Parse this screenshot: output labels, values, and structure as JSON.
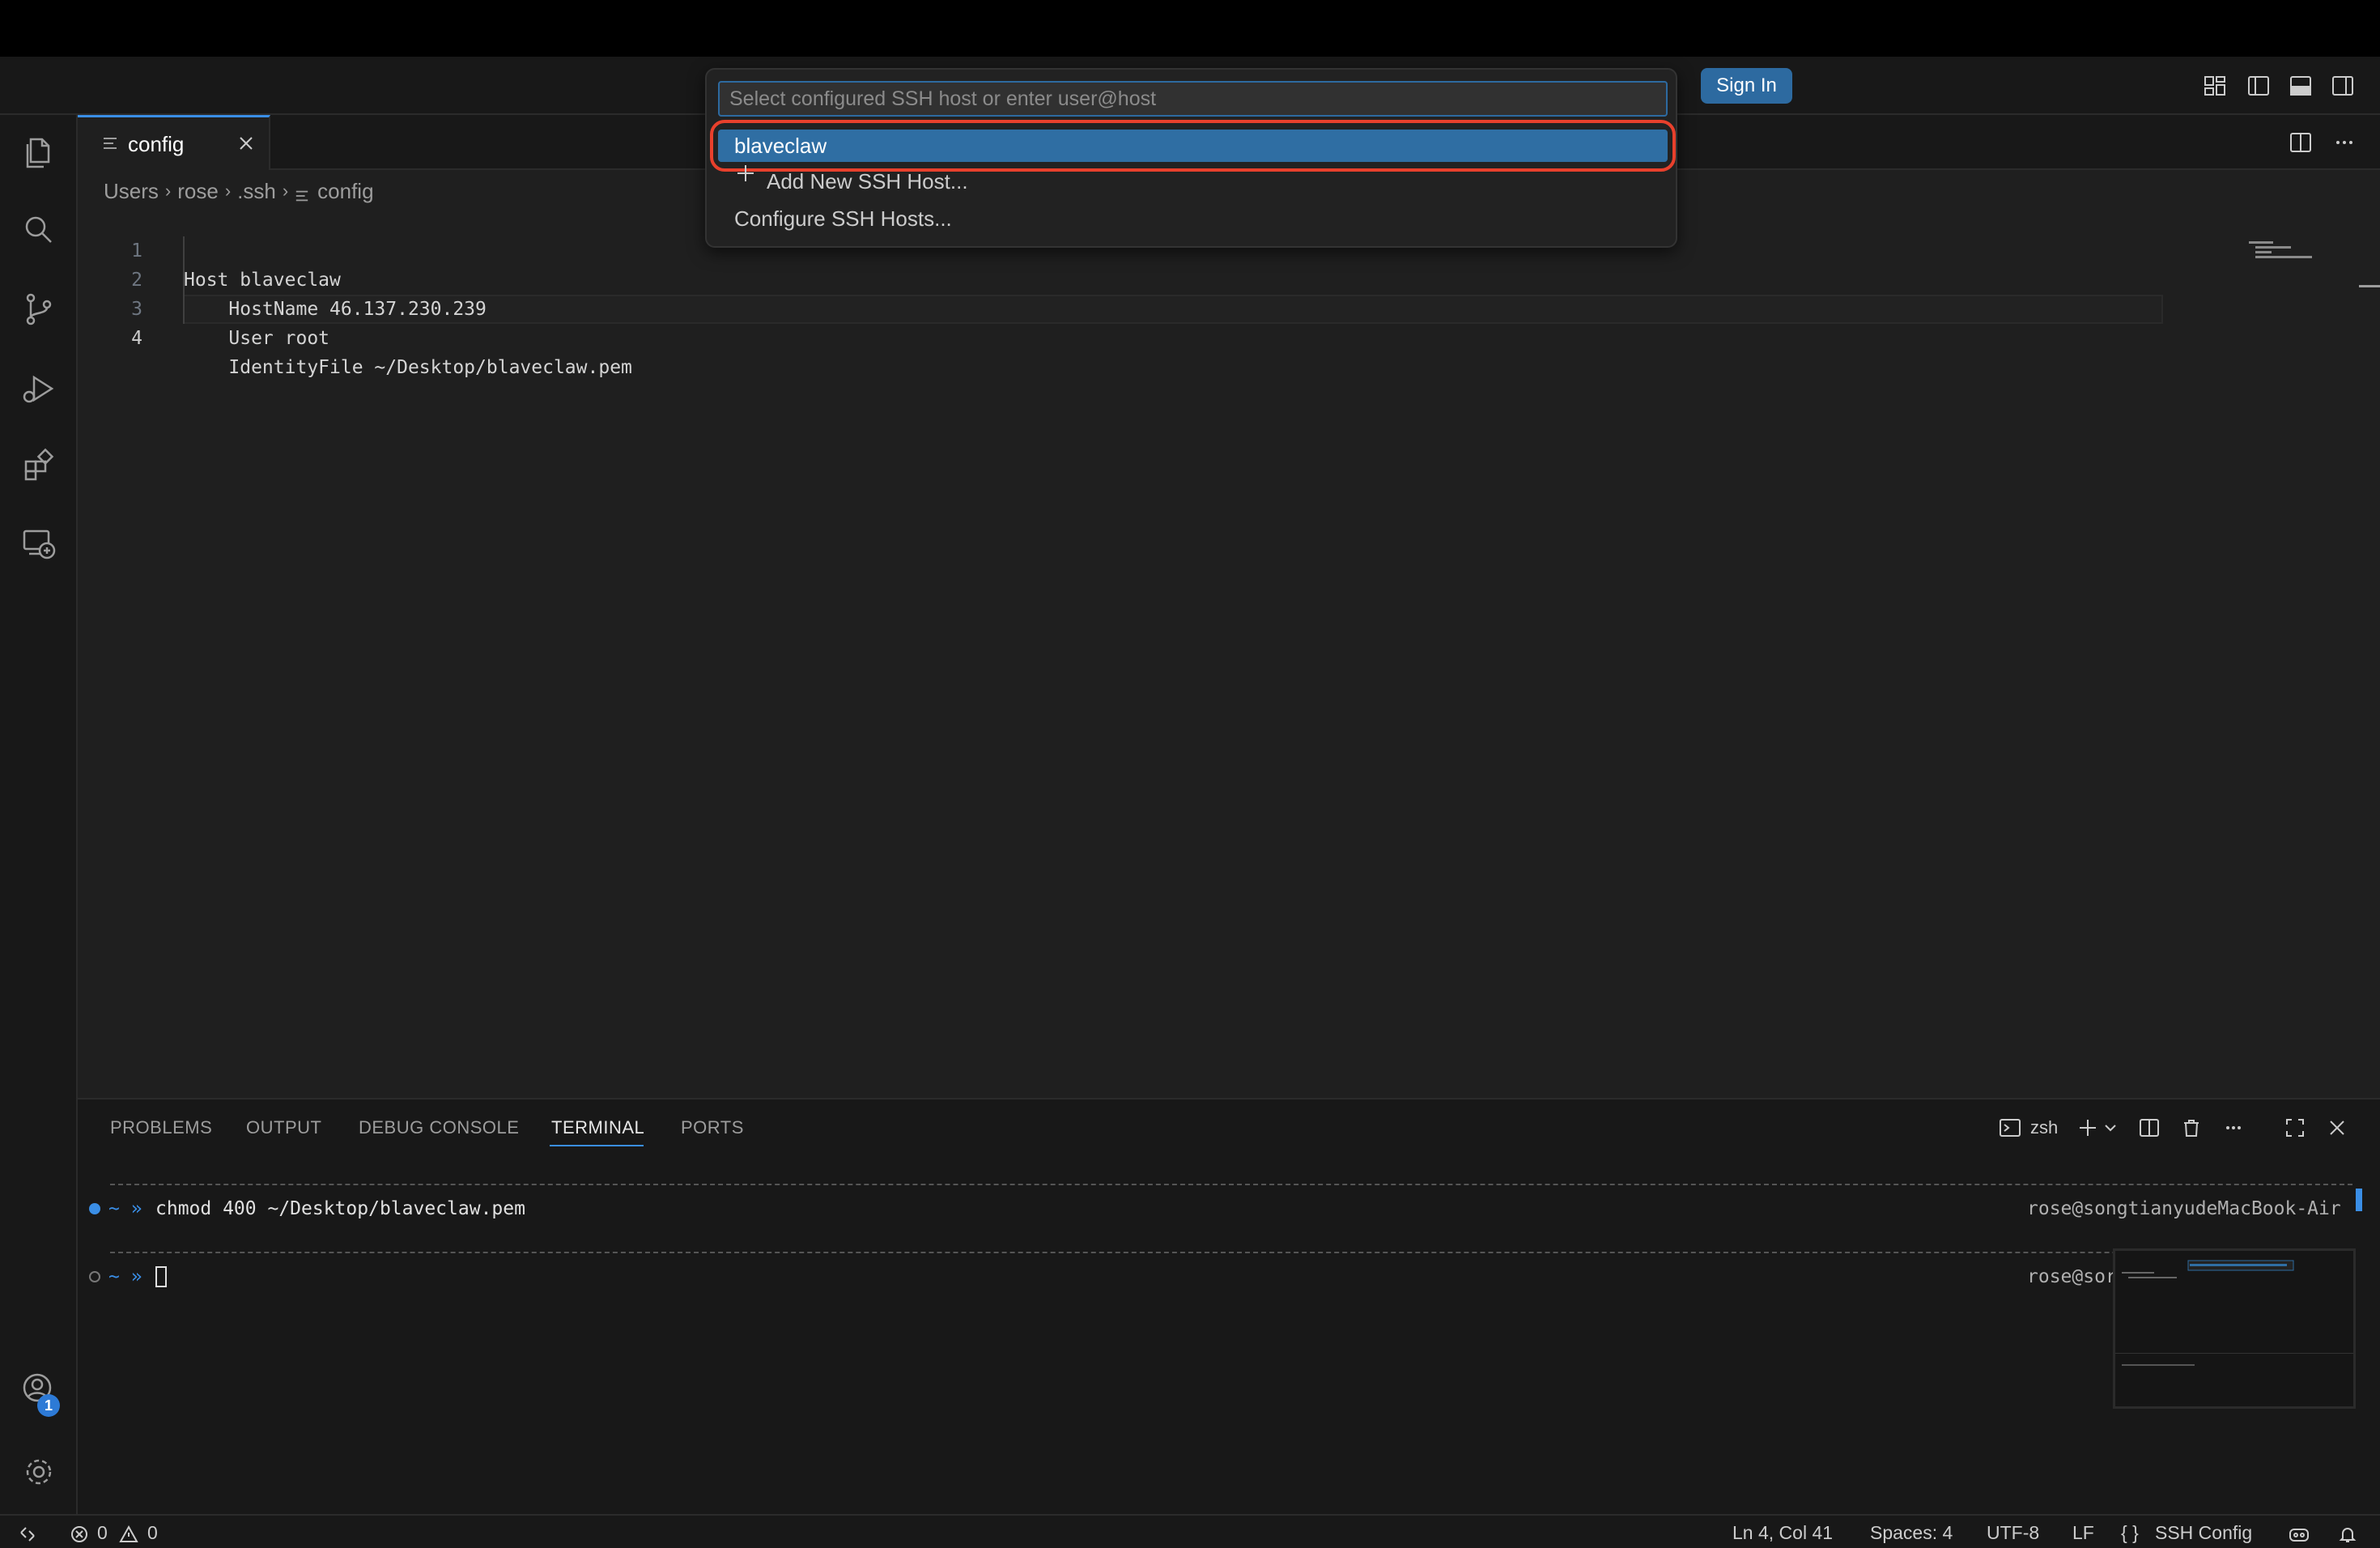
{
  "titlebar": {
    "signin_label": "Sign In"
  },
  "activity_bar": {
    "items": [
      "explorer-icon",
      "search-icon",
      "source-control-icon",
      "run-debug-icon",
      "extensions-icon",
      "remote-explorer-icon"
    ],
    "account_badge": "1"
  },
  "tab": {
    "label": "config"
  },
  "breadcrumb": {
    "parts": [
      "Users",
      "rose",
      ".ssh",
      "config"
    ]
  },
  "editor": {
    "lines": [
      {
        "num": "1",
        "text": "Host blaveclaw"
      },
      {
        "num": "2",
        "text": "    HostName 46.137.230.239"
      },
      {
        "num": "3",
        "text": "    User root"
      },
      {
        "num": "4",
        "text": "    IdentityFile ~/Desktop/blaveclaw.pem"
      }
    ]
  },
  "quickpick": {
    "placeholder": "Select configured SSH host or enter user@host",
    "items": [
      "blaveclaw",
      "Add New SSH Host...",
      "Configure SSH Hosts..."
    ]
  },
  "panel": {
    "tabs": [
      "PROBLEMS",
      "OUTPUT",
      "DEBUG CONSOLE",
      "TERMINAL",
      "PORTS"
    ],
    "active_tab": "TERMINAL",
    "shell": "zsh",
    "terminal": {
      "prompt": "~ »",
      "command": "chmod 400 ~/Desktop/blaveclaw.pem",
      "host_full": "rose@songtianyudeMacBook-Air",
      "host_partial": "rose@sor"
    }
  },
  "statusbar": {
    "errors": "0",
    "warnings": "0",
    "position": "Ln 4, Col 41",
    "spaces": "Spaces: 4",
    "encoding": "UTF-8",
    "eol": "LF",
    "language": "SSH Config",
    "language_prefix": "{ }"
  },
  "colors": {
    "accent": "#2d6aa0",
    "highlight_outline": "#e8402c",
    "selected_item": "#2f6ea3"
  }
}
